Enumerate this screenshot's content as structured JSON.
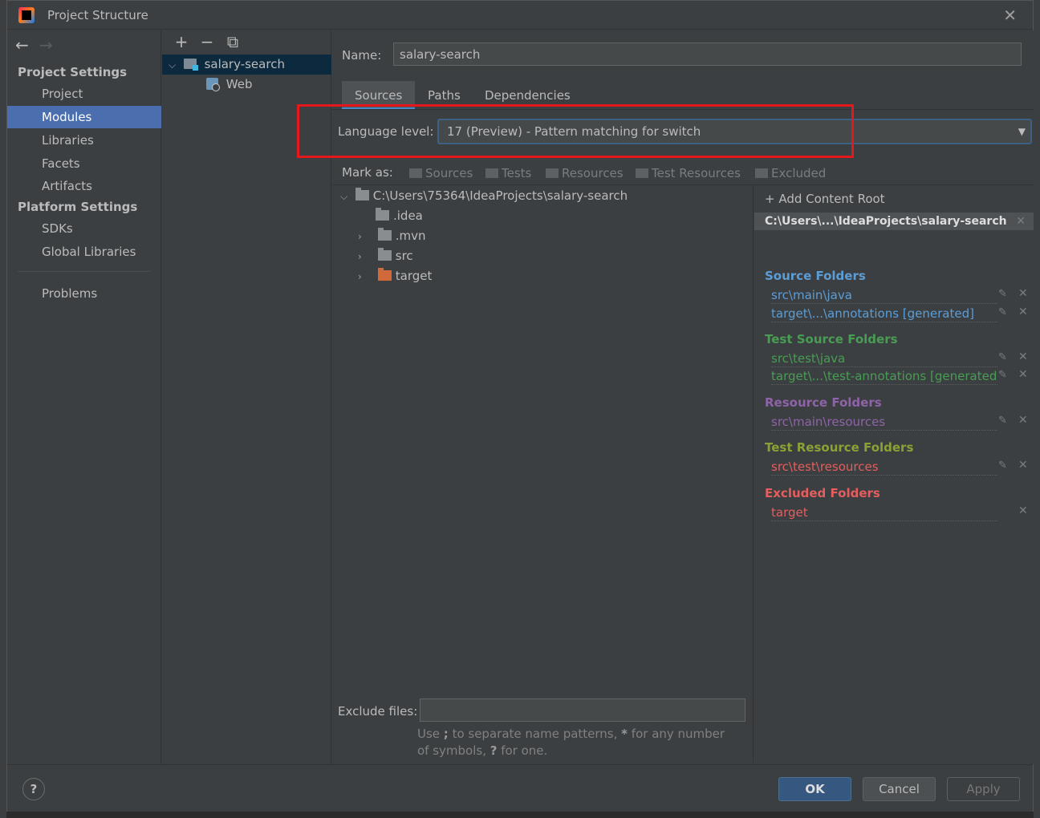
{
  "window": {
    "title": "Project Structure"
  },
  "nav": {
    "project_settings_header": "Project Settings",
    "platform_settings_header": "Platform Settings",
    "items": [
      {
        "label": "Project"
      },
      {
        "label": "Modules"
      },
      {
        "label": "Libraries"
      },
      {
        "label": "Facets"
      },
      {
        "label": "Artifacts"
      },
      {
        "label": "SDKs"
      },
      {
        "label": "Global Libraries"
      },
      {
        "label": "Problems"
      }
    ],
    "selected": "Modules"
  },
  "modules": {
    "toolbar": {
      "add": "+",
      "remove": "−",
      "copy": "⧉"
    },
    "tree": [
      {
        "label": "salary-search",
        "expanded": true
      },
      {
        "label": "Web"
      }
    ]
  },
  "main": {
    "name_label": "Name:",
    "name_value": "salary-search",
    "tabs": [
      {
        "label": "Sources"
      },
      {
        "label": "Paths"
      },
      {
        "label": "Dependencies"
      }
    ],
    "language_level_label": "Language level:",
    "language_level_value": "17 (Preview) - Pattern matching for switch",
    "mark_as_label": "Mark as:",
    "mark_buttons": [
      {
        "label": "Sources"
      },
      {
        "label": "Tests"
      },
      {
        "label": "Resources"
      },
      {
        "label": "Test Resources"
      },
      {
        "label": "Excluded"
      }
    ],
    "file_tree": [
      {
        "label": "C:\\Users\\75364\\IdeaProjects\\salary-search"
      },
      {
        "label": ".idea"
      },
      {
        "label": ".mvn"
      },
      {
        "label": "src"
      },
      {
        "label": "target"
      }
    ],
    "exclude_files_label": "Exclude files:",
    "exclude_files_value": "",
    "hint_part1": "Use ",
    "hint_semicolon": ";",
    "hint_part2": " to separate name patterns, ",
    "hint_star": "*",
    "hint_part3": " for any number of symbols, ",
    "hint_question": "?",
    "hint_part4": " for one."
  },
  "roots": {
    "add_content_root": "Add Content Root",
    "root_path": "C:\\Users\\...\\IdeaProjects\\salary-search",
    "source_folders_title": "Source Folders",
    "source_folders": [
      "src\\main\\java",
      "target\\...\\annotations [generated]"
    ],
    "test_source_folders_title": "Test Source Folders",
    "test_source_folders": [
      "src\\test\\java",
      "target\\...\\test-annotations [generated]"
    ],
    "resource_folders_title": "Resource Folders",
    "resource_folders": [
      "src\\main\\resources"
    ],
    "test_resource_folders_title": "Test Resource Folders",
    "test_resource_folders": [
      "src\\test\\resources"
    ],
    "excluded_folders_title": "Excluded Folders",
    "excluded_folders": [
      "target"
    ],
    "colors": {
      "source": "#5c9dd6",
      "test_source": "#499c54",
      "resource": "#8f63a8",
      "test_resource": "#8aa235",
      "excluded": "#e65d5d"
    }
  },
  "buttons": {
    "help": "?",
    "ok": "OK",
    "cancel": "Cancel",
    "apply": "Apply"
  }
}
